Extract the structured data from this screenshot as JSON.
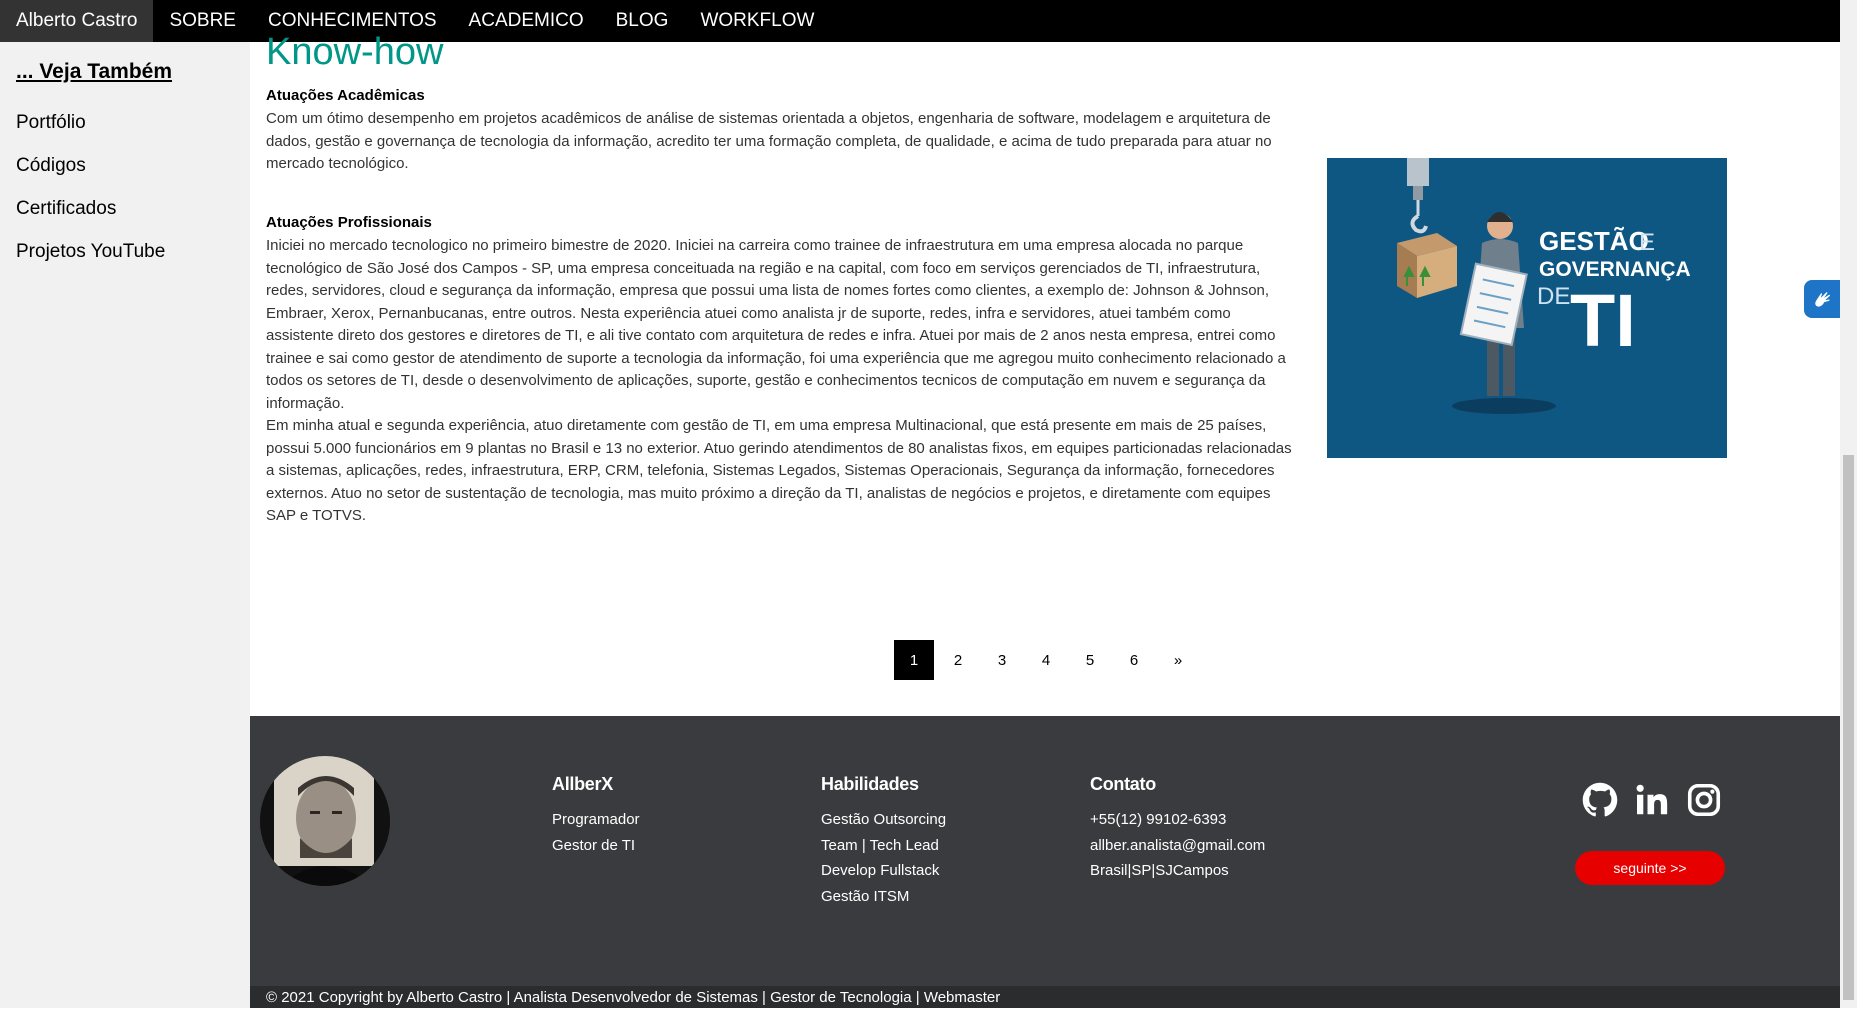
{
  "nav": {
    "brand": "Alberto Castro",
    "items": [
      "SOBRE",
      "CONHECIMENTOS",
      "ACADEMICO",
      "BLOG",
      "WORKFLOW"
    ]
  },
  "sidebar": {
    "heading": "... Veja Também",
    "items": [
      "Portfólio",
      "Códigos",
      "Certificados",
      "Projetos YouTube"
    ]
  },
  "main": {
    "title": "Know-how",
    "academic_title": "Atuações Acadêmicas",
    "academic_text": "Com um ótimo desempenho em projetos acadêmicos de análise de sistemas orientada a objetos, engenharia de software, modelagem e arquitetura de dados, gestão e governança de tecnologia da informação, acredito ter uma formação completa, de qualidade, e acima de tudo preparada para atuar no mercado tecnológico.",
    "professional_title": "Atuações Profissionais",
    "professional_text_1": "Iniciei no mercado tecnologico no primeiro bimestre de 2020. Iniciei na carreira como trainee de infraestrutura em uma empresa alocada no parque tecnológico de São José dos Campos - SP, uma empresa conceituada na região e na capital, com foco em serviços gerenciados de TI, infraestrutura, redes, servidores, cloud e segurança da informação, empresa que possui uma lista de nomes fortes como clientes, a exemplo de: Johnson & Johnson, Embraer, Xerox, Pernanbucanas, entre outros. Nesta experiência atuei como analista jr de suporte, redes, infra e servidores, atuei também como assistente direto dos gestores e diretores de TI, e ali tive contato com arquitetura de redes e infra. Atuei por mais de 2 anos nesta empresa, entrei como trainee e sai como gestor de atendimento de suporte a tecnologia da informação, foi uma experiência que me agregou muito conhecimento relacionado a todos os setores de TI, desde o desenvolvimento de aplicações, suporte, gestão e conhecimentos tecnicos de computação em nuvem e segurança da informação.",
    "professional_text_2": "Em minha atual e segunda experiência, atuo diretamente com gestão de TI, em uma empresa Multinacional, que está presente em mais de 25 países, possui 5.000 funcionários em 9 plantas no Brasil e 13 no exterior. Atuo gerindo atendimentos de 80 analistas fixos, em equipes particionadas relacionadas a sistemas, aplicações, redes, infraestrutura, ERP, CRM, telefonia, Sistemas Legados, Sistemas Operacionais, Segurança da informação, fornecedores externos. Atuo no setor de sustentação de tecnologia, mas muito próximo a direção da TI, analistas de negócios e projetos, e diretamente com equipes SAP e TOTVS.",
    "image_text": {
      "line1a": "GESTÃO",
      "line1b": "E",
      "line2": "GOVERNANÇA",
      "line3a": "DE",
      "line3b": "TI"
    }
  },
  "pagination": {
    "pages": [
      "1",
      "2",
      "3",
      "4",
      "5",
      "6"
    ],
    "next": "»",
    "active": "1"
  },
  "footer": {
    "col1": {
      "title": "AllberX",
      "items": [
        "Programador",
        "Gestor de TI"
      ]
    },
    "col2": {
      "title": "Habilidades",
      "items": [
        "Gestão Outsorcing",
        "Team | Tech Lead",
        "Develop Fullstack",
        "Gestão ITSM"
      ]
    },
    "col3": {
      "title": "Contato",
      "items": [
        "+55(12) 99102-6393",
        "allber.analista@gmail.com",
        "Brasil|SP|SJCampos"
      ]
    },
    "social": [
      "github-icon",
      "linkedin-icon",
      "instagram-icon"
    ],
    "next_button": "seguinte >>",
    "copyright": "© 2021 Copyright by Alberto Castro | Analista Desenvolvedor de Sistemas | Gestor de Tecnologia | Webmaster"
  },
  "colors": {
    "title": "#009688",
    "image_bg": "#0f5783",
    "footer_bg": "#3a3b3e",
    "accent_red": "#e60000"
  }
}
